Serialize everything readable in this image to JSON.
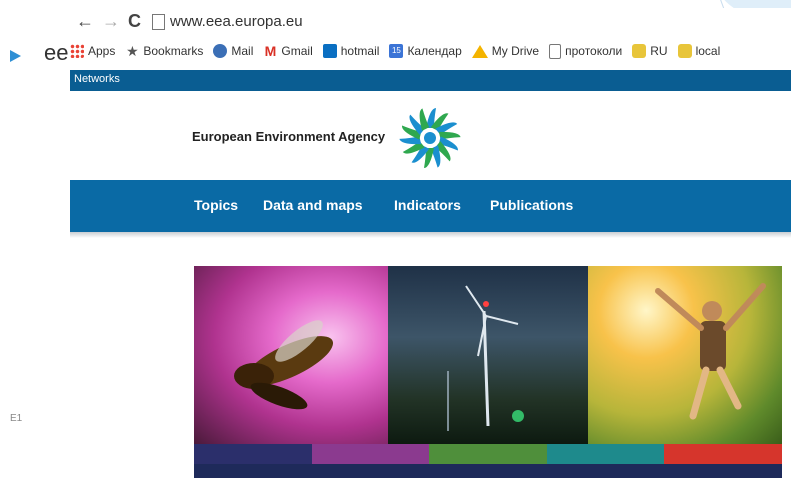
{
  "slide": {
    "bullet_text": "ee",
    "footer_code": "E1"
  },
  "browser": {
    "url": "www.eea.europa.eu",
    "bookmarks": [
      {
        "label": "Apps",
        "icon": "apps-grid-icon"
      },
      {
        "label": "Bookmarks",
        "icon": "star-icon"
      },
      {
        "label": "Mail",
        "icon": "mail-icon"
      },
      {
        "label": "Gmail",
        "icon": "gmail-icon"
      },
      {
        "label": "hotmail",
        "icon": "outlook-icon"
      },
      {
        "label": "Календар",
        "icon": "calendar-icon"
      },
      {
        "label": "My Drive",
        "icon": "drive-icon"
      },
      {
        "label": "протоколи",
        "icon": "page-icon"
      },
      {
        "label": "RU",
        "icon": "bookmark-folder-icon"
      },
      {
        "label": "local",
        "icon": "bookmark-folder-icon"
      }
    ]
  },
  "site": {
    "networks_label": "Networks",
    "agency_name": "European Environment Agency",
    "nav": [
      "Topics",
      "Data and maps",
      "Indicators",
      "Publications"
    ],
    "colors": {
      "top_bar": "#0a5d92",
      "nav_bar": "#0a6aa5",
      "band": [
        "#2b2f6b",
        "#8b3a8f",
        "#4f8f3b",
        "#1e8a8c",
        "#d6352c"
      ],
      "bottom_strip": "#1e2a5a"
    }
  }
}
